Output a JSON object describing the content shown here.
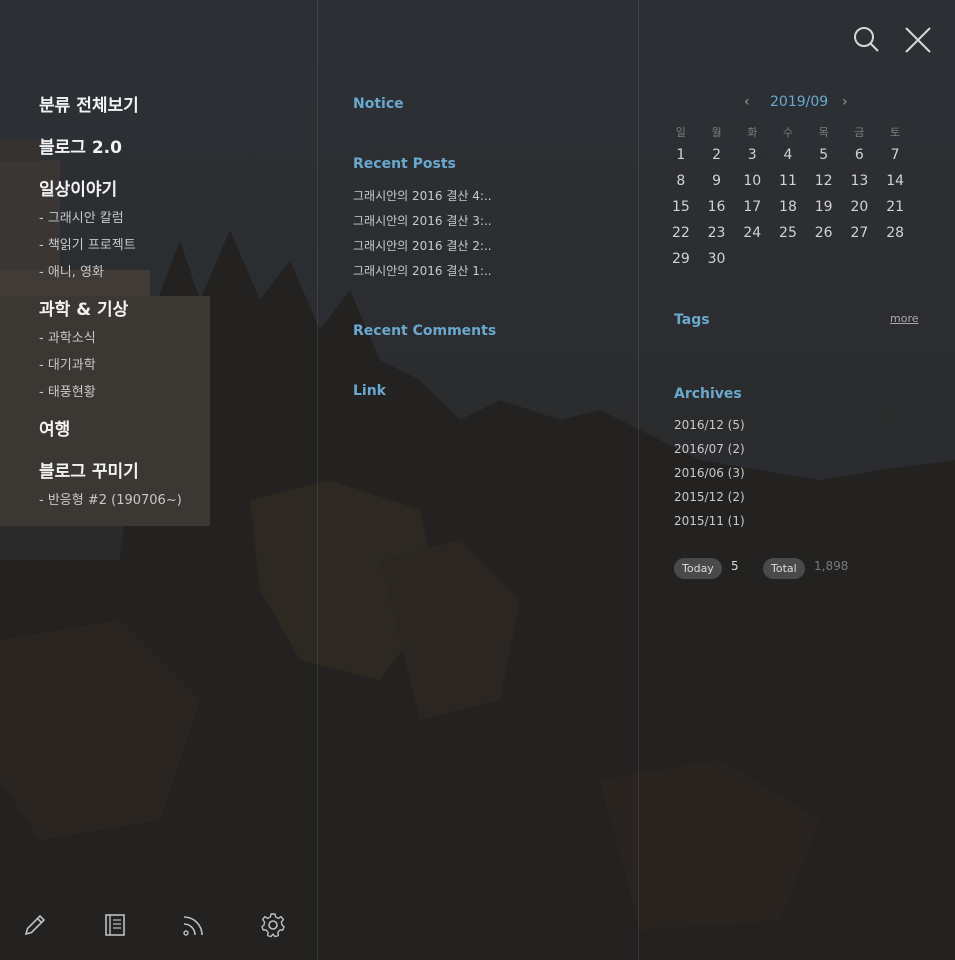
{
  "colors": {
    "accent": "#6aa9cf",
    "background": "#272727"
  },
  "toolbar": {
    "search_icon": "search-icon",
    "close_icon": "close-icon"
  },
  "categories": {
    "all": "분류 전체보기",
    "blog2": "블로그 2.0",
    "daily": "일상이야기",
    "daily_items": [
      "- 그래시안 칼럼",
      "- 책읽기 프로젝트",
      "- 애니, 영화"
    ],
    "science": "과학 & 기상",
    "science_items": [
      "- 과학소식",
      "- 대기과학",
      "- 태풍현황"
    ],
    "travel": "여행",
    "decor": "블로그 꾸미기",
    "decor_items": [
      "- 반응형 #2 (190706~)"
    ]
  },
  "sidebar_mid": {
    "notice": "Notice",
    "recent_posts": "Recent Posts",
    "posts": [
      "그래시안의 2016 결산 4:..",
      "그래시안의 2016 결산 3:..",
      "그래시안의 2016 결산 2:..",
      "그래시안의 2016 결산 1:.."
    ],
    "recent_comments": "Recent Comments",
    "link": "Link"
  },
  "calendar": {
    "prev": "‹",
    "title": "2019/09",
    "next": "›",
    "weekdays": [
      "일",
      "월",
      "화",
      "수",
      "목",
      "금",
      "토"
    ],
    "weeks": [
      [
        "1",
        "2",
        "3",
        "4",
        "5",
        "6",
        "7"
      ],
      [
        "8",
        "9",
        "10",
        "11",
        "12",
        "13",
        "14"
      ],
      [
        "15",
        "16",
        "17",
        "18",
        "19",
        "20",
        "21"
      ],
      [
        "22",
        "23",
        "24",
        "25",
        "26",
        "27",
        "28"
      ],
      [
        "29",
        "30",
        "",
        "",
        "",
        "",
        ""
      ]
    ]
  },
  "tags": {
    "title": "Tags",
    "more": "more"
  },
  "archives": {
    "title": "Archives",
    "items": [
      "2016/12 (5)",
      "2016/07 (2)",
      "2016/06 (3)",
      "2015/12 (2)",
      "2015/11 (1)"
    ]
  },
  "counter": {
    "today_label": "Today",
    "today_value": "5",
    "total_label": "Total",
    "total_value": "1,898"
  },
  "bottom_icons": [
    "pencil-icon",
    "notebook-icon",
    "rss-icon",
    "gear-icon"
  ]
}
